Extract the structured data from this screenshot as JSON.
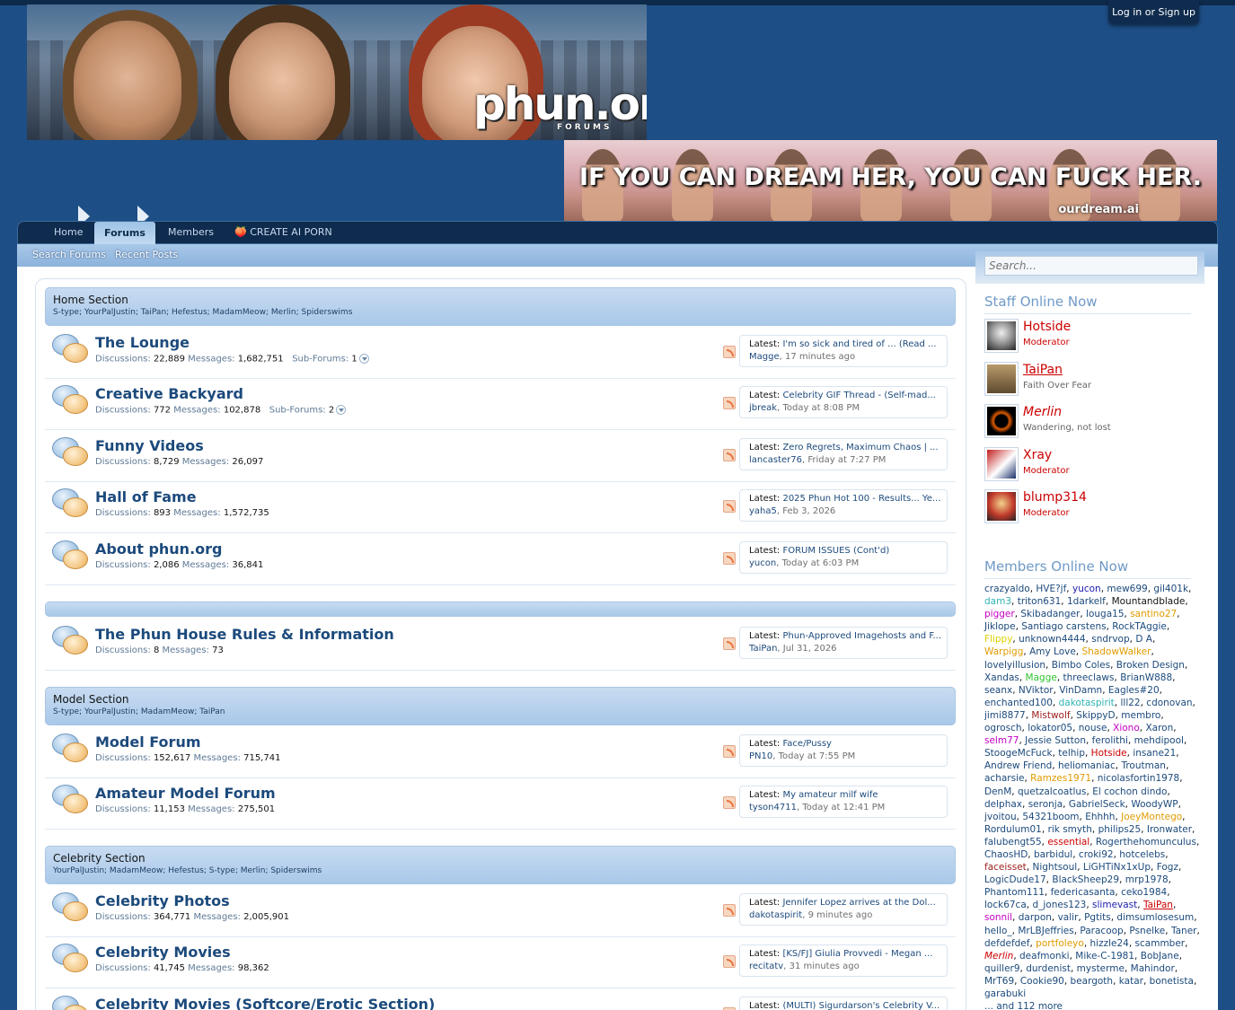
{
  "header": {
    "login_label": "Log in or Sign up",
    "logo_text": "phun.org",
    "logo_sub": "FORUMS",
    "ad_text": "IF YOU CAN DREAM HER, YOU CAN FUCK HER.",
    "ad_url": "ourdream.ai"
  },
  "nav": {
    "tabs": [
      "Home",
      "Forums",
      "Members",
      "🍑 CREATE AI PORN"
    ],
    "subnav": [
      "Search Forums",
      "Recent Posts"
    ]
  },
  "search": {
    "placeholder": "Search..."
  },
  "sections": [
    {
      "title": "Home Section",
      "mods": "S-type; YourPalJustin; TaiPan; Hefestus; MadamMeow; Merlin; Spiderswims"
    },
    {
      "title": "",
      "mods": ""
    },
    {
      "title": "Model Section",
      "mods": "S-type; YourPalJustin; MadamMeow; TaiPan"
    },
    {
      "title": "Celebrity Section",
      "mods": "YourPalJustin; MadamMeow; Hefestus; S-type; Merlin; Spiderswims"
    }
  ],
  "nodes": [
    {
      "title": "The Lounge",
      "discussions": "22,889",
      "messages": "1,682,751",
      "subforums": "1",
      "latest_title": "I'm so sick and tired of ... (Read ...",
      "latest_user": "Magge",
      "latest_time": "17 minutes ago"
    },
    {
      "title": "Creative Backyard",
      "discussions": "772",
      "messages": "102,878",
      "subforums": "2",
      "latest_title": "Celebrity GIF Thread - (Self-mad...",
      "latest_user": "jbreak",
      "latest_time": "Today at 8:08 PM"
    },
    {
      "title": "Funny Videos",
      "discussions": "8,729",
      "messages": "26,097",
      "subforums": "",
      "latest_title": "Zero Regrets, Maximum Chaos | ...",
      "latest_user": "lancaster76",
      "latest_time": "Friday at 7:27 PM"
    },
    {
      "title": "Hall of Fame",
      "discussions": "893",
      "messages": "1,572,735",
      "subforums": "",
      "latest_title": "2025 Phun Hot 100 - Results... Ye...",
      "latest_user": "yaha5",
      "latest_time": "Feb 3, 2026"
    },
    {
      "title": "About phun.org",
      "discussions": "2,086",
      "messages": "36,841",
      "subforums": "",
      "latest_title": "FORUM ISSUES (Cont'd)",
      "latest_user": "yucon",
      "latest_time": "Today at 6:03 PM"
    },
    {
      "title": "The Phun House Rules & Information",
      "discussions": "8",
      "messages": "73",
      "subforums": "",
      "latest_title": "Phun-Approved Imagehosts and F...",
      "latest_user": "TaiPan",
      "latest_time": "Jul 31, 2026"
    },
    {
      "title": "Model Forum",
      "discussions": "152,617",
      "messages": "715,741",
      "subforums": "",
      "latest_title": "Face/Pussy",
      "latest_user": "PN10",
      "latest_time": "Today at 7:55 PM"
    },
    {
      "title": "Amateur Model Forum",
      "discussions": "11,153",
      "messages": "275,501",
      "subforums": "",
      "latest_title": "My amateur milf wife",
      "latest_user": "tyson4711",
      "latest_time": "Today at 12:41 PM"
    },
    {
      "title": "Celebrity Photos",
      "discussions": "364,771",
      "messages": "2,005,901",
      "subforums": "",
      "latest_title": "Jennifer Lopez arrives at the Dol...",
      "latest_user": "dakotaspirit",
      "latest_time": "9 minutes ago"
    },
    {
      "title": "Celebrity Movies",
      "discussions": "41,745",
      "messages": "98,362",
      "subforums": "",
      "latest_title": "[KS/FJ] Giulia Provvedi - Megan ...",
      "latest_user": "recitatv",
      "latest_time": "31 minutes ago"
    },
    {
      "title": "Celebrity Movies (Softcore/Erotic Section)",
      "discussions": "",
      "messages": "",
      "subforums": "",
      "latest_title": "(MULTI) Sigurdarson's Celebrity V...",
      "latest_user": "",
      "latest_time": ""
    }
  ],
  "labels": {
    "discussions": "Discussions:",
    "messages": "Messages:",
    "subforums": "Sub-Forums:",
    "latest": "Latest:"
  },
  "staff_online": {
    "title": "Staff Online Now",
    "members": [
      {
        "name": "Hotside",
        "title": "Moderator",
        "color": "#cc0000",
        "italic": false,
        "underline": false
      },
      {
        "name": "TaiPan",
        "title": "Faith Over Fear",
        "color": "#cc0000",
        "italic": false,
        "underline": true
      },
      {
        "name": "Merlin",
        "title": "Wandering, not lost",
        "color": "#cc0000",
        "italic": true,
        "underline": false
      },
      {
        "name": "Xray",
        "title": "Moderator",
        "color": "#cc0000",
        "italic": false,
        "underline": false
      },
      {
        "name": "blump314",
        "title": "Moderator",
        "color": "#cc0000",
        "italic": false,
        "underline": false
      }
    ]
  },
  "members_online": {
    "title": "Members Online Now",
    "more": "... and 112 more",
    "names": [
      [
        "crazyaldo",
        ""
      ],
      [
        "HVE?jf",
        ""
      ],
      [
        "yucon",
        "#1c1cb0"
      ],
      [
        "mew699",
        ""
      ],
      [
        "gil401k",
        ""
      ],
      [
        "dam3",
        "#2fb3b3"
      ],
      [
        "triton631",
        ""
      ],
      [
        "1darkelf",
        ""
      ],
      [
        "Mountandblade",
        "#141414"
      ],
      [
        "pigger",
        "#c400c4"
      ],
      [
        "Skibadanger",
        ""
      ],
      [
        "louga15",
        ""
      ],
      [
        "santino27",
        "#e09b00"
      ],
      [
        "Jiklope",
        ""
      ],
      [
        "Santiago carstens",
        ""
      ],
      [
        "RockTAggie",
        ""
      ],
      [
        "Flippy",
        "#e0d000"
      ],
      [
        "unknown4444",
        ""
      ],
      [
        "sndrvop",
        ""
      ],
      [
        "D A",
        ""
      ],
      [
        "Warpigg",
        "#e09b00"
      ],
      [
        "Amy Love",
        ""
      ],
      [
        "ShadowWalker",
        "#e09b00"
      ],
      [
        "lovelyillusion",
        ""
      ],
      [
        "Bimbo Coles",
        ""
      ],
      [
        "Broken Design",
        ""
      ],
      [
        "Xandas",
        ""
      ],
      [
        "Magge",
        "#2fc42f"
      ],
      [
        "threeclaws",
        ""
      ],
      [
        "BrianW888",
        ""
      ],
      [
        "seanx",
        ""
      ],
      [
        "NViktor",
        ""
      ],
      [
        "VinDamn",
        ""
      ],
      [
        "Eagles#20",
        ""
      ],
      [
        "enchanted100",
        ""
      ],
      [
        "dakotaspirit",
        "#2fb3b3"
      ],
      [
        "lll22",
        ""
      ],
      [
        "cdonovan",
        ""
      ],
      [
        "jimi8877",
        ""
      ],
      [
        "Mistwolf",
        "#9b1c1c"
      ],
      [
        "SkippyD",
        ""
      ],
      [
        "membro",
        ""
      ],
      [
        "ogrosch",
        ""
      ],
      [
        "lokator05",
        ""
      ],
      [
        "nouse",
        ""
      ],
      [
        "Xiono",
        "#c400c4"
      ],
      [
        "Xaron",
        ""
      ],
      [
        "selm77",
        "#c400c4"
      ],
      [
        "Jessie Sutton",
        ""
      ],
      [
        "ferolithi",
        ""
      ],
      [
        "mehdipool",
        ""
      ],
      [
        "StoogeMcFuck",
        ""
      ],
      [
        "telhip",
        ""
      ],
      [
        "Hotside",
        "#cc0000"
      ],
      [
        "insane21",
        ""
      ],
      [
        "Andrew Friend",
        ""
      ],
      [
        "heliomaniac",
        ""
      ],
      [
        "Troutman",
        ""
      ],
      [
        "acharsie",
        ""
      ],
      [
        "Ramzes1971",
        "#e09b00"
      ],
      [
        "nicolasfortin1978",
        ""
      ],
      [
        "DenM",
        ""
      ],
      [
        "quetzalcoatlus",
        ""
      ],
      [
        "El cochon dindo",
        ""
      ],
      [
        "delphax",
        ""
      ],
      [
        "seronja",
        ""
      ],
      [
        "GabrielSeck",
        ""
      ],
      [
        "WoodyWP",
        ""
      ],
      [
        "jvoitou",
        ""
      ],
      [
        "54321boom",
        ""
      ],
      [
        "Ehhhh",
        ""
      ],
      [
        "JoeyMontego",
        "#e09b00"
      ],
      [
        "Rordulum01",
        ""
      ],
      [
        "rik smyth",
        ""
      ],
      [
        "philips25",
        ""
      ],
      [
        "Ironwater",
        ""
      ],
      [
        "falubengt55",
        ""
      ],
      [
        "essential",
        "#cc0000"
      ],
      [
        "Rogerthehomunculus",
        ""
      ],
      [
        "ChaosHD",
        ""
      ],
      [
        "barbidul",
        ""
      ],
      [
        "croki92",
        ""
      ],
      [
        "hotcelebs",
        ""
      ],
      [
        "faceisset",
        "#9b1c1c"
      ],
      [
        "Nightsoul",
        ""
      ],
      [
        "LiGHTiNx1xUp",
        ""
      ],
      [
        "Fogz",
        ""
      ],
      [
        "LogicDude17",
        ""
      ],
      [
        "BlackSheep29",
        ""
      ],
      [
        "mrp1978",
        ""
      ],
      [
        "Phantom111",
        ""
      ],
      [
        "federicasanta",
        ""
      ],
      [
        "ceko1984",
        ""
      ],
      [
        "lock67ca",
        ""
      ],
      [
        "d_jones123",
        ""
      ],
      [
        "slimevast",
        "#1c1cb0"
      ],
      [
        "TaiPan",
        "#cc0000"
      ],
      [
        "sonnil",
        "#c400c4"
      ],
      [
        "darpon",
        ""
      ],
      [
        "valir",
        ""
      ],
      [
        "Pgtits",
        ""
      ],
      [
        "dimsumlosesum",
        ""
      ],
      [
        "hello_",
        ""
      ],
      [
        "MrLBJeffries",
        ""
      ],
      [
        "Paracoop",
        ""
      ],
      [
        "Psnelke",
        ""
      ],
      [
        "Taner",
        ""
      ],
      [
        "defdefdef",
        ""
      ],
      [
        "portfoleyo",
        "#e09b00"
      ],
      [
        "hizzle24",
        ""
      ],
      [
        "scammber",
        ""
      ],
      [
        "Merlin",
        "#cc0000"
      ],
      [
        "deafmonki",
        ""
      ],
      [
        "Mike-C-1981",
        ""
      ],
      [
        "BobJane",
        ""
      ],
      [
        "quiller9",
        ""
      ],
      [
        "durdenist",
        ""
      ],
      [
        "mysterme",
        ""
      ],
      [
        "Mahindor",
        ""
      ],
      [
        "MrT69",
        ""
      ],
      [
        "Cookie90",
        ""
      ],
      [
        "beargoth",
        ""
      ],
      [
        "katar",
        ""
      ],
      [
        "bonetista",
        ""
      ],
      [
        "garabuki",
        ""
      ]
    ]
  },
  "colors": {
    "page_bg": "#1d4e86",
    "nav_bg": "#0f2b4d",
    "link": "#1c4a7c",
    "section_head": "#b8d3ee",
    "member_default": "#1c4a7c"
  }
}
